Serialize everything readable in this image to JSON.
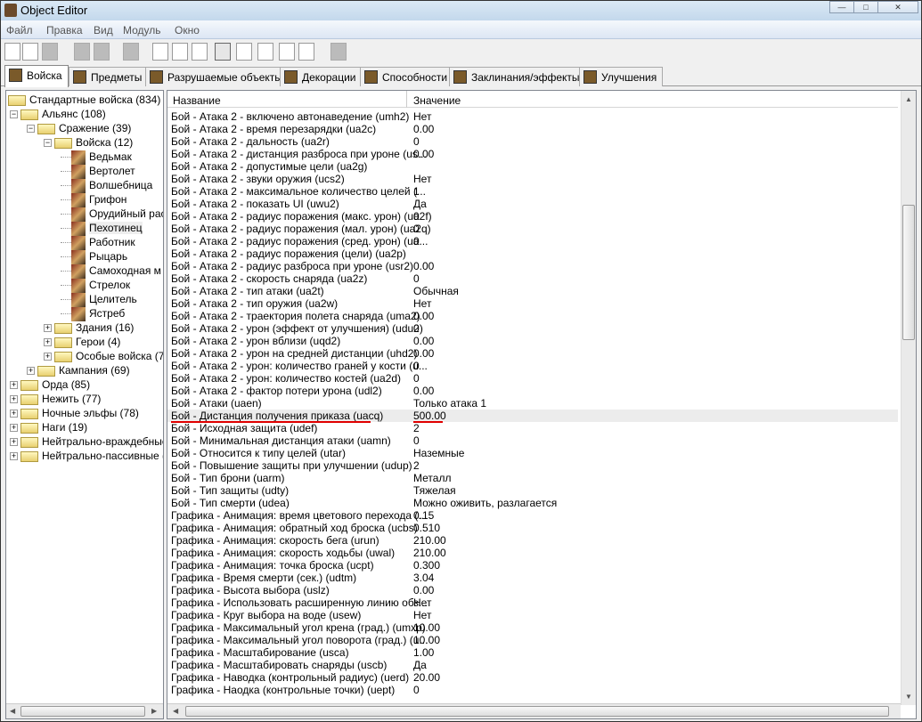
{
  "window": {
    "title": "Object Editor"
  },
  "menu": [
    "Файл",
    "Правка",
    "Вид",
    "Модуль",
    "Окно"
  ],
  "toolbar": [
    "new-icon",
    "open-icon",
    "save-icon",
    "copy-icon",
    "paste-icon",
    "delete-icon",
    "terrain-icon",
    "text-icon",
    "sound-icon",
    "units-icon",
    "items-icon",
    "doodads-icon",
    "cube-icon",
    "import-icon",
    "export-icon"
  ],
  "tabs": [
    {
      "label": "Войска",
      "active": true
    },
    {
      "label": "Предметы"
    },
    {
      "label": "Разрушаемые объекты"
    },
    {
      "label": "Декорации"
    },
    {
      "label": "Способности"
    },
    {
      "label": "Заклинания/эффекты"
    },
    {
      "label": "Улучшения"
    }
  ],
  "tree": [
    {
      "label": "Стандартные войска (834)",
      "level": 0,
      "type": "folder",
      "exp": ""
    },
    {
      "label": "Альянс (108)",
      "level": 1,
      "type": "folder",
      "exp": "-"
    },
    {
      "label": "Сражение (39)",
      "level": 2,
      "type": "folder",
      "exp": "-"
    },
    {
      "label": "Войска (12)",
      "level": 3,
      "type": "folder",
      "exp": "-"
    },
    {
      "label": "Ведьмак",
      "level": 4,
      "type": "unit"
    },
    {
      "label": "Вертолет",
      "level": 4,
      "type": "unit"
    },
    {
      "label": "Волшебница",
      "level": 4,
      "type": "unit"
    },
    {
      "label": "Грифон",
      "level": 4,
      "type": "unit"
    },
    {
      "label": "Орудийный расчет",
      "level": 4,
      "type": "unit"
    },
    {
      "label": "Пехотинец",
      "level": 4,
      "type": "unit",
      "selected": true
    },
    {
      "label": "Работник",
      "level": 4,
      "type": "unit"
    },
    {
      "label": "Рыцарь",
      "level": 4,
      "type": "unit"
    },
    {
      "label": "Самоходная м",
      "level": 4,
      "type": "unit"
    },
    {
      "label": "Стрелок",
      "level": 4,
      "type": "unit"
    },
    {
      "label": "Целитель",
      "level": 4,
      "type": "unit"
    },
    {
      "label": "Ястреб",
      "level": 4,
      "type": "unit"
    },
    {
      "label": "Здания (16)",
      "level": 3,
      "type": "folder",
      "exp": "+"
    },
    {
      "label": "Герои (4)",
      "level": 3,
      "type": "folder",
      "exp": "+"
    },
    {
      "label": "Особые войска (7)",
      "level": 3,
      "type": "folder",
      "exp": "+"
    },
    {
      "label": "Кампания (69)",
      "level": 2,
      "type": "folder",
      "exp": "+"
    },
    {
      "label": "Орда (85)",
      "level": 1,
      "type": "folder",
      "exp": "+"
    },
    {
      "label": "Нежить (77)",
      "level": 1,
      "type": "folder",
      "exp": "+"
    },
    {
      "label": "Ночные эльфы (78)",
      "level": 1,
      "type": "folder",
      "exp": "+"
    },
    {
      "label": "Наги (19)",
      "level": 1,
      "type": "folder",
      "exp": "+"
    },
    {
      "label": "Нейтрально-враждебные",
      "level": 1,
      "type": "folder",
      "exp": "+"
    },
    {
      "label": "Нейтрально-пассивные (1",
      "level": 1,
      "type": "folder",
      "exp": "+"
    }
  ],
  "list": {
    "headers": {
      "name": "Название",
      "value": "Значение"
    },
    "rows": [
      [
        "Бой - Атака 2 - включено автонаведение (umh2)",
        "Нет"
      ],
      [
        "Бой - Атака 2 - время перезарядки (ua2c)",
        "0.00"
      ],
      [
        "Бой - Атака 2 - дальность (ua2r)",
        "0"
      ],
      [
        "Бой - Атака 2 - дистанция разброса при уроне (us...",
        "0.00"
      ],
      [
        "Бой - Атака 2 - допустимые цели (ua2g)",
        ""
      ],
      [
        "Бой - Атака 2 - звуки оружия (ucs2)",
        "Нет"
      ],
      [
        "Бой - Атака 2 - максимальное количество целей (...",
        "1"
      ],
      [
        "Бой - Атака 2 - показать UI (uwu2)",
        "Да"
      ],
      [
        "Бой - Атака 2 - радиус поражения (макс. урон) (ua2f)",
        "0"
      ],
      [
        "Бой - Атака 2 - радиус поражения (мал. урон) (ua2q)",
        "0"
      ],
      [
        "Бой - Атака 2 - радиус поражения (сред. урон) (ua...",
        "0"
      ],
      [
        "Бой - Атака 2 - радиус поражения (цели) (ua2p)",
        ""
      ],
      [
        "Бой - Атака 2 - радиус разброса при уроне (usr2)",
        "0.00"
      ],
      [
        "Бой - Атака 2 - скорость снаряда (ua2z)",
        "0"
      ],
      [
        "Бой - Атака 2 - тип атаки (ua2t)",
        "Обычная"
      ],
      [
        "Бой - Атака 2 - тип оружия (ua2w)",
        "Нет"
      ],
      [
        "Бой - Атака 2 - траектория полета снаряда (uma2)",
        "0.00"
      ],
      [
        "Бой - Атака 2 - урон (эффект от улучшения) (udu2)",
        "0"
      ],
      [
        "Бой - Атака 2 - урон вблизи (uqd2)",
        "0.00"
      ],
      [
        "Бой - Атака 2 - урон на средней дистанции (uhd2)",
        "0.00"
      ],
      [
        "Бой - Атака 2 - урон: количество граней у кости (u...",
        "0"
      ],
      [
        "Бой - Атака 2 - урон: количество костей (ua2d)",
        "0"
      ],
      [
        "Бой - Атака 2 - фактор потери урона (udl2)",
        "0.00"
      ],
      [
        "Бой - Атаки (uaen)",
        "Только атака 1"
      ],
      [
        "Бой - Дистанция получения приказа (uacq)",
        "500.00"
      ],
      [
        "Бой - Исходная защита (udef)",
        "2"
      ],
      [
        "Бой - Минимальная дистанция атаки (uamn)",
        "0"
      ],
      [
        "Бой - Относится к типу целей (utar)",
        "Наземные"
      ],
      [
        "Бой - Повышение защиты при улучшении (udup)",
        "2"
      ],
      [
        "Бой - Тип брони (uarm)",
        "Металл"
      ],
      [
        "Бой - Тип защиты (udty)",
        "Тяжелая"
      ],
      [
        "Бой - Тип смерти (udea)",
        "Можно оживить, разлагается"
      ],
      [
        "Графика - Анимация: время цветового перехода (...",
        "0.15"
      ],
      [
        "Графика - Анимация: обратный ход броска (ucbs)",
        "0.510"
      ],
      [
        "Графика - Анимация: скорость бега (urun)",
        "210.00"
      ],
      [
        "Графика - Анимация: скорость ходьбы (uwal)",
        "210.00"
      ],
      [
        "Графика - Анимация: точка броска (ucpt)",
        "0.300"
      ],
      [
        "Графика - Время смерти (сек.) (udtm)",
        "3.04"
      ],
      [
        "Графика - Высота выбора (uslz)",
        "0.00"
      ],
      [
        "Графика - Использовать расширенную линию обз...",
        "Нет"
      ],
      [
        "Графика - Круг выбора на воде (usew)",
        "Нет"
      ],
      [
        "Графика - Максимальный угол крена (град.) (umxp)",
        "10.00"
      ],
      [
        "Графика - Максимальный угол поворота (град.) (u...",
        "10.00"
      ],
      [
        "Графика - Масштабирование (usca)",
        "1.00"
      ],
      [
        "Графика - Масштабировать снаряды (uscb)",
        "Да"
      ],
      [
        "Графика - Наводка (контрольный радиус) (uerd)",
        "20.00"
      ],
      [
        "Графика - Наодка (контрольные точки) (uept)",
        "0"
      ]
    ],
    "highlighted_index": 24,
    "annotation_color": "#e00000"
  }
}
